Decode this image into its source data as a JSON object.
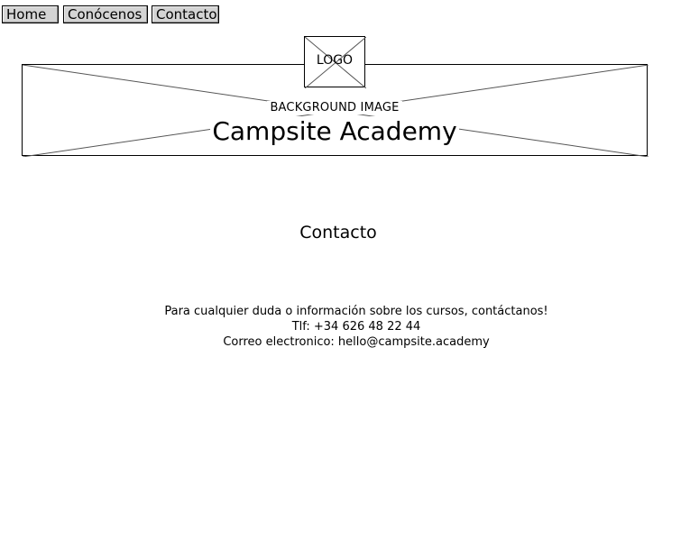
{
  "nav": {
    "items": [
      {
        "label": "Home"
      },
      {
        "label": "Conócenos"
      },
      {
        "label": "Contacto"
      }
    ]
  },
  "header": {
    "logo_label": "LOGO",
    "background_label": "BACKGROUND IMAGE",
    "site_title": "Campsite Academy"
  },
  "main": {
    "title": "Contacto",
    "intro": "Para cualquier duda o información sobre los cursos, contáctanos!",
    "phone": "Tlf:  +34 626 48 22 44",
    "email": "Correo electronico: hello@campsite.academy"
  }
}
